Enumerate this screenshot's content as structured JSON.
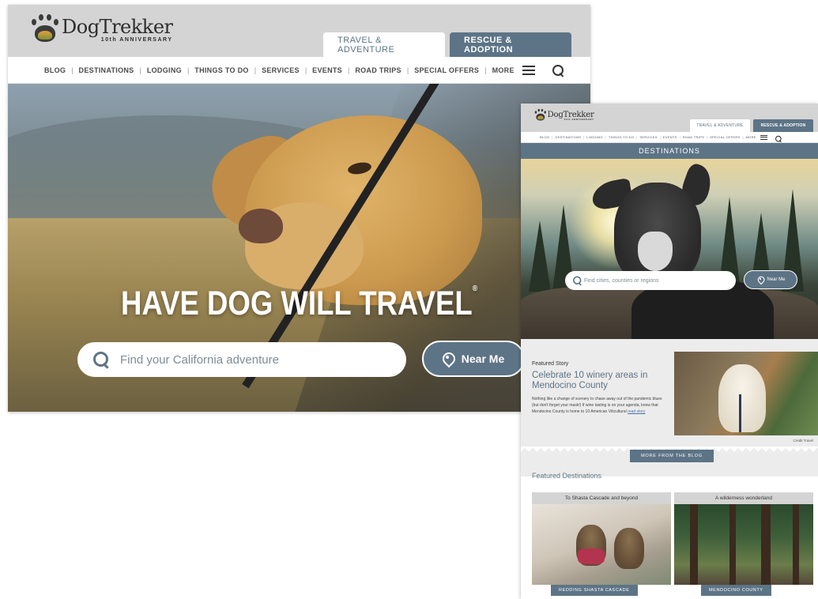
{
  "desktop": {
    "logo": {
      "name": "DogTrekker",
      "sub": "10th ANNIVERSARY"
    },
    "tabs": [
      {
        "label": "TRAVEL & ADVENTURE",
        "active": true
      },
      {
        "label": "RESCUE & ADOPTION",
        "active": false
      }
    ],
    "nav": [
      "BLOG",
      "DESTINATIONS",
      "LODGING",
      "THINGS TO DO",
      "SERVICES",
      "EVENTS",
      "ROAD TRIPS",
      "SPECIAL OFFERS",
      "MORE"
    ],
    "hero": {
      "title": "HAVE DOG WILL TRAVEL",
      "trademark": "®",
      "search_placeholder": "Find your California adventure",
      "near_me": "Near Me"
    }
  },
  "page2": {
    "logo": {
      "name": "DogTrekker",
      "sub": "10th ANNIVERSARY"
    },
    "tabs": [
      {
        "label": "TRAVEL & ADVENTURE",
        "active": true
      },
      {
        "label": "RESCUE & ADOPTION",
        "active": false
      }
    ],
    "nav": [
      "BLOG",
      "DESTINATIONS",
      "LODGING",
      "THINGS TO DO",
      "SERVICES",
      "EVENTS",
      "ROAD TRIPS",
      "SPECIAL OFFERS",
      "MORE"
    ],
    "banner": "DESTINATIONS",
    "hero": {
      "search_placeholder": "Find cities, counties or regions",
      "near_me": "Near Me"
    },
    "featured_story": {
      "label": "Featured Story",
      "title": "Celebrate 10 winery areas in Mendocino County",
      "body": "Nothing like a change of scenery to chase away out of the pandemic blues (but don't forget your mask!) If wine tasting is on your agenda, know that Mendocino County is home to 10 American Viticultural",
      "link": "read story",
      "credit": "Credit Travel",
      "more_button": "MORE FROM THE BLOG"
    },
    "featured_destinations": {
      "heading": "Featured Destinations",
      "cards": [
        {
          "title": "To Shasta Cascade and beyond",
          "caption": "REDDING SHASTA CASCADE"
        },
        {
          "title": "A wilderness wonderland",
          "caption": "MENDOCINO COUNTY"
        }
      ]
    }
  },
  "colors": {
    "brand_slate": "#5d7486",
    "header_gray": "#d4d4d4",
    "section_gray": "#ececec"
  }
}
